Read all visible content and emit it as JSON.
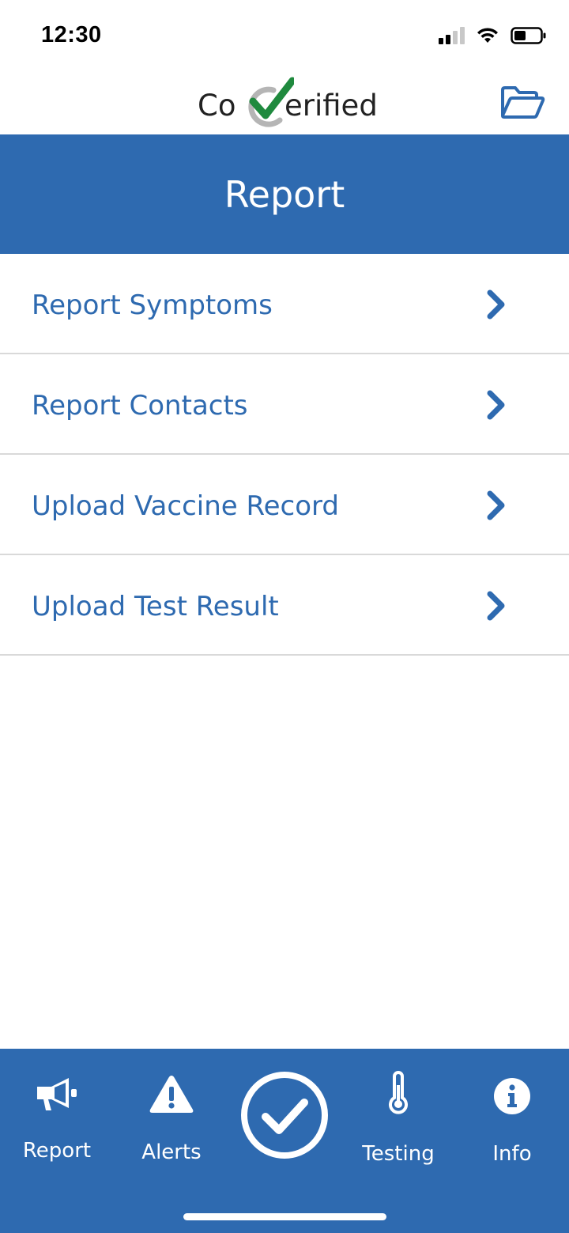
{
  "status_bar": {
    "time": "12:30"
  },
  "header": {
    "logo_left": "Co",
    "logo_right": "erified",
    "folder_icon": "folder-open-icon"
  },
  "page": {
    "title": "Report"
  },
  "menu": {
    "items": [
      {
        "label": "Report Symptoms"
      },
      {
        "label": "Report Contacts"
      },
      {
        "label": "Upload Vaccine Record"
      },
      {
        "label": "Upload Test Result"
      }
    ]
  },
  "tab_bar": {
    "tabs": [
      {
        "label": "Report",
        "icon": "megaphone-icon"
      },
      {
        "label": "Alerts",
        "icon": "warning-icon"
      },
      {
        "label": "Testing",
        "icon": "thermometer-icon"
      },
      {
        "label": "Info",
        "icon": "info-icon"
      }
    ],
    "center_icon": "check-circle-icon"
  },
  "colors": {
    "brand_blue": "#2e6ab0",
    "logo_green": "#1f8a3e",
    "divider": "#d9d9d9"
  }
}
